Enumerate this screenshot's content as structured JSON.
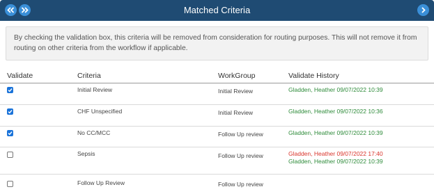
{
  "header": {
    "title": "Matched Criteria",
    "colors": {
      "bar": "#1f4b73",
      "button": "#3a8fd8"
    }
  },
  "notice": {
    "text": "By checking the validation box, this criteria will be removed from consideration for routing purposes. This will not remove it from routing on other criteria from the workflow if applicable."
  },
  "table": {
    "columns": [
      "Validate",
      "Criteria",
      "WorkGroup",
      "Validate History"
    ],
    "rows": [
      {
        "checked": true,
        "criteria": "Initial Review",
        "workgroup": "Initial Review",
        "history": [
          {
            "text": "Gladden, Heather 09/07/2022 10:39",
            "color": "#2e8b3a"
          }
        ]
      },
      {
        "checked": true,
        "criteria": "CHF Unspecified",
        "workgroup": "Initial Review",
        "history": [
          {
            "text": "Gladden, Heather 09/07/2022 10:36",
            "color": "#2e8b3a"
          }
        ]
      },
      {
        "checked": true,
        "criteria": "No CC/MCC",
        "workgroup": "Follow Up review",
        "history": [
          {
            "text": "Gladden, Heather 09/07/2022 10:39",
            "color": "#2e8b3a"
          }
        ]
      },
      {
        "checked": false,
        "criteria": "Sepsis",
        "workgroup": "Follow Up review",
        "history": [
          {
            "text": "Gladden, Heather 09/07/2022 17:40",
            "color": "#d9342b"
          },
          {
            "text": "Gladden, Heather 09/07/2022 10:39",
            "color": "#2e8b3a"
          }
        ]
      },
      {
        "checked": false,
        "criteria": "Follow Up Review",
        "workgroup": "Follow Up review",
        "history": []
      }
    ]
  }
}
